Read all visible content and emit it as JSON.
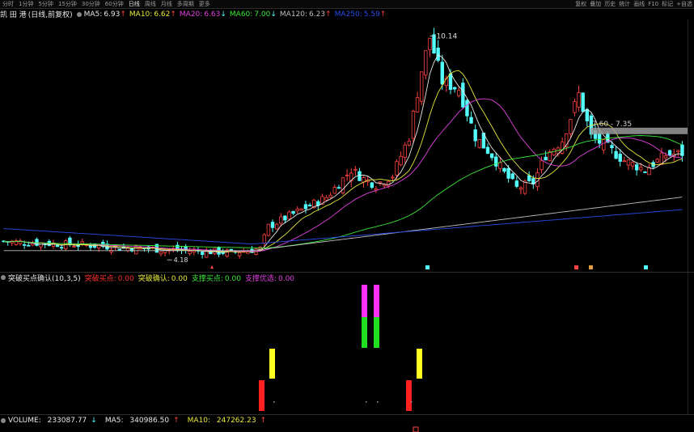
{
  "toolbar": {
    "left": [
      "分时",
      "1分钟",
      "5分钟",
      "15分钟",
      "30分钟",
      "60分钟",
      "日线",
      "周线",
      "月线",
      "多周期",
      "更多"
    ],
    "active": "日线",
    "right": [
      "复权",
      "叠加",
      "历史",
      "统计",
      "画线",
      "F10",
      "标记",
      "+自选"
    ]
  },
  "stock": {
    "name": "凯 田 港",
    "mode": "(日线,前复权)"
  },
  "ma_legend": [
    {
      "label": "MA5:",
      "value": "6.93",
      "arrow": "↑",
      "color": "#e8e8e8"
    },
    {
      "label": "MA10:",
      "value": "6.62",
      "arrow": "↑",
      "color": "#e8e83a"
    },
    {
      "label": "MA20:",
      "value": "6.63",
      "arrow": "↓",
      "color": "#e040e0"
    },
    {
      "label": "MA60:",
      "value": "7.00",
      "arrow": "↓",
      "color": "#3ae83a"
    },
    {
      "label": "MA120:",
      "value": "6.23",
      "arrow": "↑",
      "color": "#bdbdbd"
    },
    {
      "label": "MA250:",
      "value": "5.59",
      "arrow": "↑",
      "color": "#2a4ae8"
    }
  ],
  "annotations": {
    "high": "10.14",
    "low": "4.18",
    "target": "7.60 - 7.35"
  },
  "indicator": {
    "name": "突破买点确认(10,3,5)",
    "items": [
      {
        "label": "突破买点:",
        "value": "0.00",
        "color": "#ff3030"
      },
      {
        "label": "突破确认:",
        "value": "0.00",
        "color": "#e8e83a"
      },
      {
        "label": "支撑买点:",
        "value": "0.00",
        "color": "#3ae83a"
      },
      {
        "label": "支撑优选:",
        "value": "0.00",
        "color": "#e040e0"
      }
    ]
  },
  "volume": {
    "label": "VOLUME:",
    "value": "233087.77",
    "arrow": "↓",
    "ma5_label": "MA5:",
    "ma5": "340986.50",
    "ma5_arrow": "↑",
    "ma10_label": "MA10:",
    "ma10": "247262.23",
    "ma10_arrow": "↑"
  },
  "colors": {
    "up": "#ff4040",
    "down": "#54ffff",
    "ma5": "#e8e8e8",
    "ma10": "#e8e83a",
    "ma20": "#e040e0",
    "ma60": "#3ae83a",
    "ma120": "#bdbdbd",
    "ma250": "#2a4ae8"
  }
}
